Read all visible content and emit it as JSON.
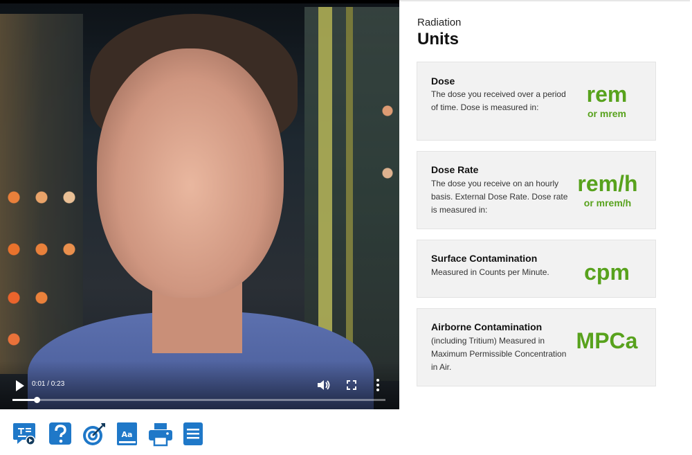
{
  "video": {
    "time_display": "0:01 / 0:23",
    "progress_fraction": 0.065
  },
  "panel": {
    "kicker": "Radiation",
    "heading": "Units"
  },
  "cards": [
    {
      "title": "Dose",
      "description": "The dose you received over a period of time. Dose is measured in:",
      "unit": "rem",
      "unit_alt": "or mrem"
    },
    {
      "title": "Dose Rate",
      "description": "The dose you receive on an hourly basis. External Dose Rate. Dose rate is measured in:",
      "unit": "rem/h",
      "unit_alt": "or mrem/h"
    },
    {
      "title": "Surface Contamination",
      "description": "Measured in Counts per Minute.",
      "unit": "cpm"
    },
    {
      "title": "Airborne Contamination",
      "description": "(including Tritium) Measured in Maximum Permissible Concentration in Air.",
      "unit": "MPCa"
    }
  ],
  "toolbar": {
    "icons": [
      "transcript-icon",
      "help-icon",
      "objectives-icon",
      "glossary-icon",
      "print-icon",
      "notes-icon"
    ]
  },
  "colors": {
    "accent_green": "#58a21d",
    "toolbar_blue": "#1f78c8"
  }
}
